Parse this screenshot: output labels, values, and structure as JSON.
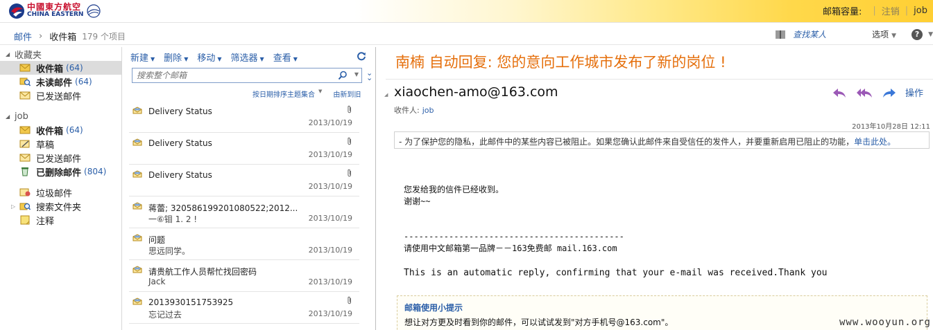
{
  "header": {
    "brand_cn": "中國東方航空",
    "brand_en": "CHINA EASTERN",
    "quota_label": "邮箱容量:",
    "logout": "注销",
    "user": "job"
  },
  "breadcrumb": {
    "root": "邮件",
    "current": "收件箱",
    "count": "179 个项目",
    "find_person": "查找某人",
    "options": "选项",
    "help": "?"
  },
  "folders": {
    "favorites_label": "收藏夹",
    "favorites": [
      {
        "name": "收件箱",
        "count": "(64)",
        "bold": true,
        "selected": true,
        "icon": "inbox-icon"
      },
      {
        "name": "未读邮件",
        "count": "(64)",
        "bold": true,
        "selected": false,
        "icon": "unread-search-icon"
      },
      {
        "name": "已发送邮件",
        "count": "",
        "bold": false,
        "selected": false,
        "icon": "sent-icon"
      }
    ],
    "mailbox_label": "job",
    "mailbox": [
      {
        "name": "收件箱",
        "count": "(64)",
        "bold": true,
        "icon": "inbox-icon"
      },
      {
        "name": "草稿",
        "count": "",
        "bold": false,
        "icon": "drafts-icon"
      },
      {
        "name": "已发送邮件",
        "count": "",
        "bold": false,
        "icon": "sent-icon"
      },
      {
        "name": "已删除邮件",
        "count": "(804)",
        "bold": true,
        "icon": "deleted-icon"
      }
    ],
    "other": [
      {
        "name": "垃圾邮件",
        "icon": "junk-icon"
      },
      {
        "name": "搜索文件夹",
        "icon": "search-folder-icon"
      },
      {
        "name": "注释",
        "icon": "notes-icon"
      }
    ]
  },
  "toolbar": {
    "new": "新建",
    "delete": "删除",
    "move": "移动",
    "filter": "筛选器",
    "view": "查看"
  },
  "search": {
    "placeholder": "搜索整个邮箱"
  },
  "sort": {
    "by": "按日期排序主题集合",
    "order": "由新到旧"
  },
  "messages": [
    {
      "subject": "Delivery Status",
      "preview": "",
      "date": "2013/10/19",
      "attachment": true
    },
    {
      "subject": "Delivery Status",
      "preview": "",
      "date": "2013/10/19",
      "attachment": true
    },
    {
      "subject": "Delivery Status",
      "preview": "",
      "date": "2013/10/19",
      "attachment": true
    },
    {
      "subject": "蒋蕾; 320586199201080522;2012...",
      "preview": "一⑥钼 1. 2 !",
      "date": "2013/10/19",
      "attachment": false
    },
    {
      "subject": "问题",
      "preview": "思远同学。",
      "date": "2013/10/19",
      "attachment": false
    },
    {
      "subject": "请贵航工作人员帮忙找回密码",
      "preview": "Jack",
      "date": "2013/10/19",
      "attachment": false
    },
    {
      "subject": "2013930151753925",
      "preview": "忘记过去",
      "date": "2013/10/19",
      "attachment": true
    }
  ],
  "reading": {
    "title": "南楠 自动回复: 您的意向工作城市发布了新的岗位 !",
    "from": "xiaochen-amo@163.com",
    "to_label": "收件人:",
    "to": "job",
    "action_label": "操作",
    "date": "2013年10月28日 12:11",
    "warning": "- 为了保护您的隐私，此邮件中的某些内容已被阻止。如果您确认此邮件来自受信任的发件人，并要重新启用已阻止的功能，",
    "warning_link": "单击此处。",
    "body_line1": "您发给我的信件已经收到。",
    "body_line2": "谢谢~~",
    "divider": "--------------------------------------------",
    "body_line3": "请使用中文邮箱第一品牌－－163免费邮 mail.163.com",
    "body_en": "This is an automatic reply, confirming that your e-mail was received.Thank you",
    "tips_title": "邮箱使用小提示",
    "tips_text": "想让对方更及时看到你的邮件，可以试试发到\"对方手机号@163.com\"。"
  },
  "watermark": "www.wooyun.org",
  "colors": {
    "accent_blue": "#2a5ea8",
    "title_orange": "#e56f0c",
    "brand_red": "#c8102e"
  }
}
